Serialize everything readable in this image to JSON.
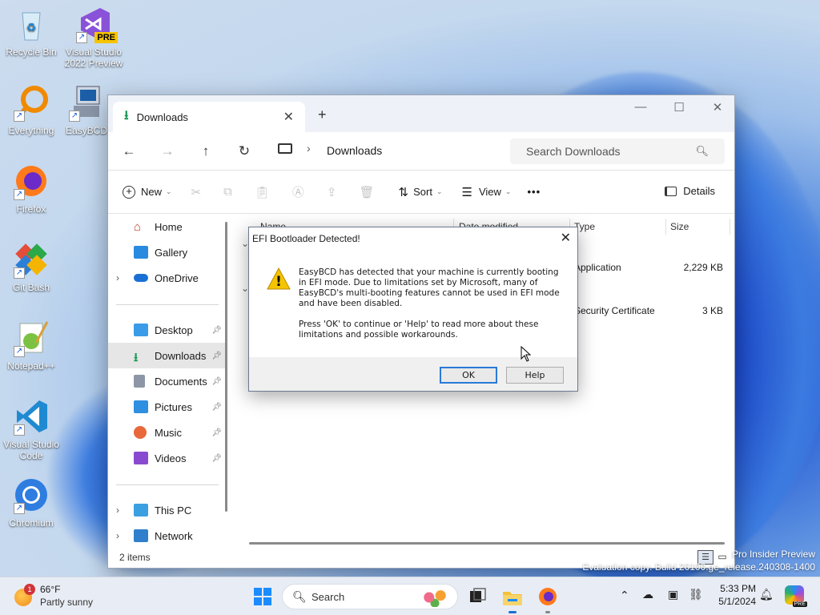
{
  "colors": {
    "accent": "#0067c0",
    "folder": "#f3c13a",
    "dialog_default": "#2a7ad8"
  },
  "desktop_icons": [
    {
      "label": "Recycle Bin",
      "icon": "recycle-bin-icon"
    },
    {
      "label": "Visual Studio 2022 Preview",
      "badge": "PRE",
      "icon": "visual-studio-icon"
    },
    {
      "label": "Everything",
      "icon": "everything-search-icon"
    },
    {
      "label": "EasyBCD",
      "icon": "easybcd-icon"
    },
    {
      "label": "Firefox",
      "icon": "firefox-icon"
    },
    {
      "label": "Git Bash",
      "icon": "git-bash-icon"
    },
    {
      "label": "Notepad++",
      "icon": "notepadpp-icon"
    },
    {
      "label": "Visual Studio Code",
      "icon": "vscode-icon"
    },
    {
      "label": "Chromium",
      "icon": "chromium-icon"
    }
  ],
  "explorer": {
    "tab_title": "Downloads",
    "breadcrumb": "Downloads",
    "search_placeholder": "Search Downloads",
    "toolbar": {
      "new": "New",
      "sort": "Sort",
      "view": "View",
      "more": "•••",
      "details": "Details"
    },
    "sidebar": {
      "quick": [
        {
          "label": "Home"
        },
        {
          "label": "Gallery"
        },
        {
          "label": "OneDrive"
        }
      ],
      "pinned": [
        {
          "label": "Desktop"
        },
        {
          "label": "Downloads"
        },
        {
          "label": "Documents"
        },
        {
          "label": "Pictures"
        },
        {
          "label": "Music"
        },
        {
          "label": "Videos"
        }
      ],
      "drives": [
        {
          "label": "This PC"
        },
        {
          "label": "Network"
        }
      ]
    },
    "columns": {
      "name": "Name",
      "date": "Date modified",
      "type": "Type",
      "size": "Size"
    },
    "files": [
      {
        "type": "Application",
        "size": "2,229 KB"
      },
      {
        "type": "Security Certificate",
        "size": "3 KB"
      }
    ],
    "status": "2 items"
  },
  "dialog": {
    "title": "EFI Bootloader Detected!",
    "message1": "EasyBCD has detected that your machine is currently booting in EFI mode. Due to limitations set by Microsoft, many of EasyBCD's multi-booting features cannot be used in EFI mode and have been disabled.",
    "message2": "Press 'OK' to continue or 'Help' to read more about these limitations and possible workarounds.",
    "ok": "OK",
    "help": "Help"
  },
  "watermark": {
    "line1": "Pro Insider Preview",
    "line2": "Evaluation copy. Build 26100.ge_release.240308-1400"
  },
  "taskbar": {
    "weather_temp": "66°F",
    "weather_desc": "Partly sunny",
    "weather_badge": "1",
    "search": "Search",
    "time": "5:33 PM",
    "date": "5/1/2024"
  }
}
